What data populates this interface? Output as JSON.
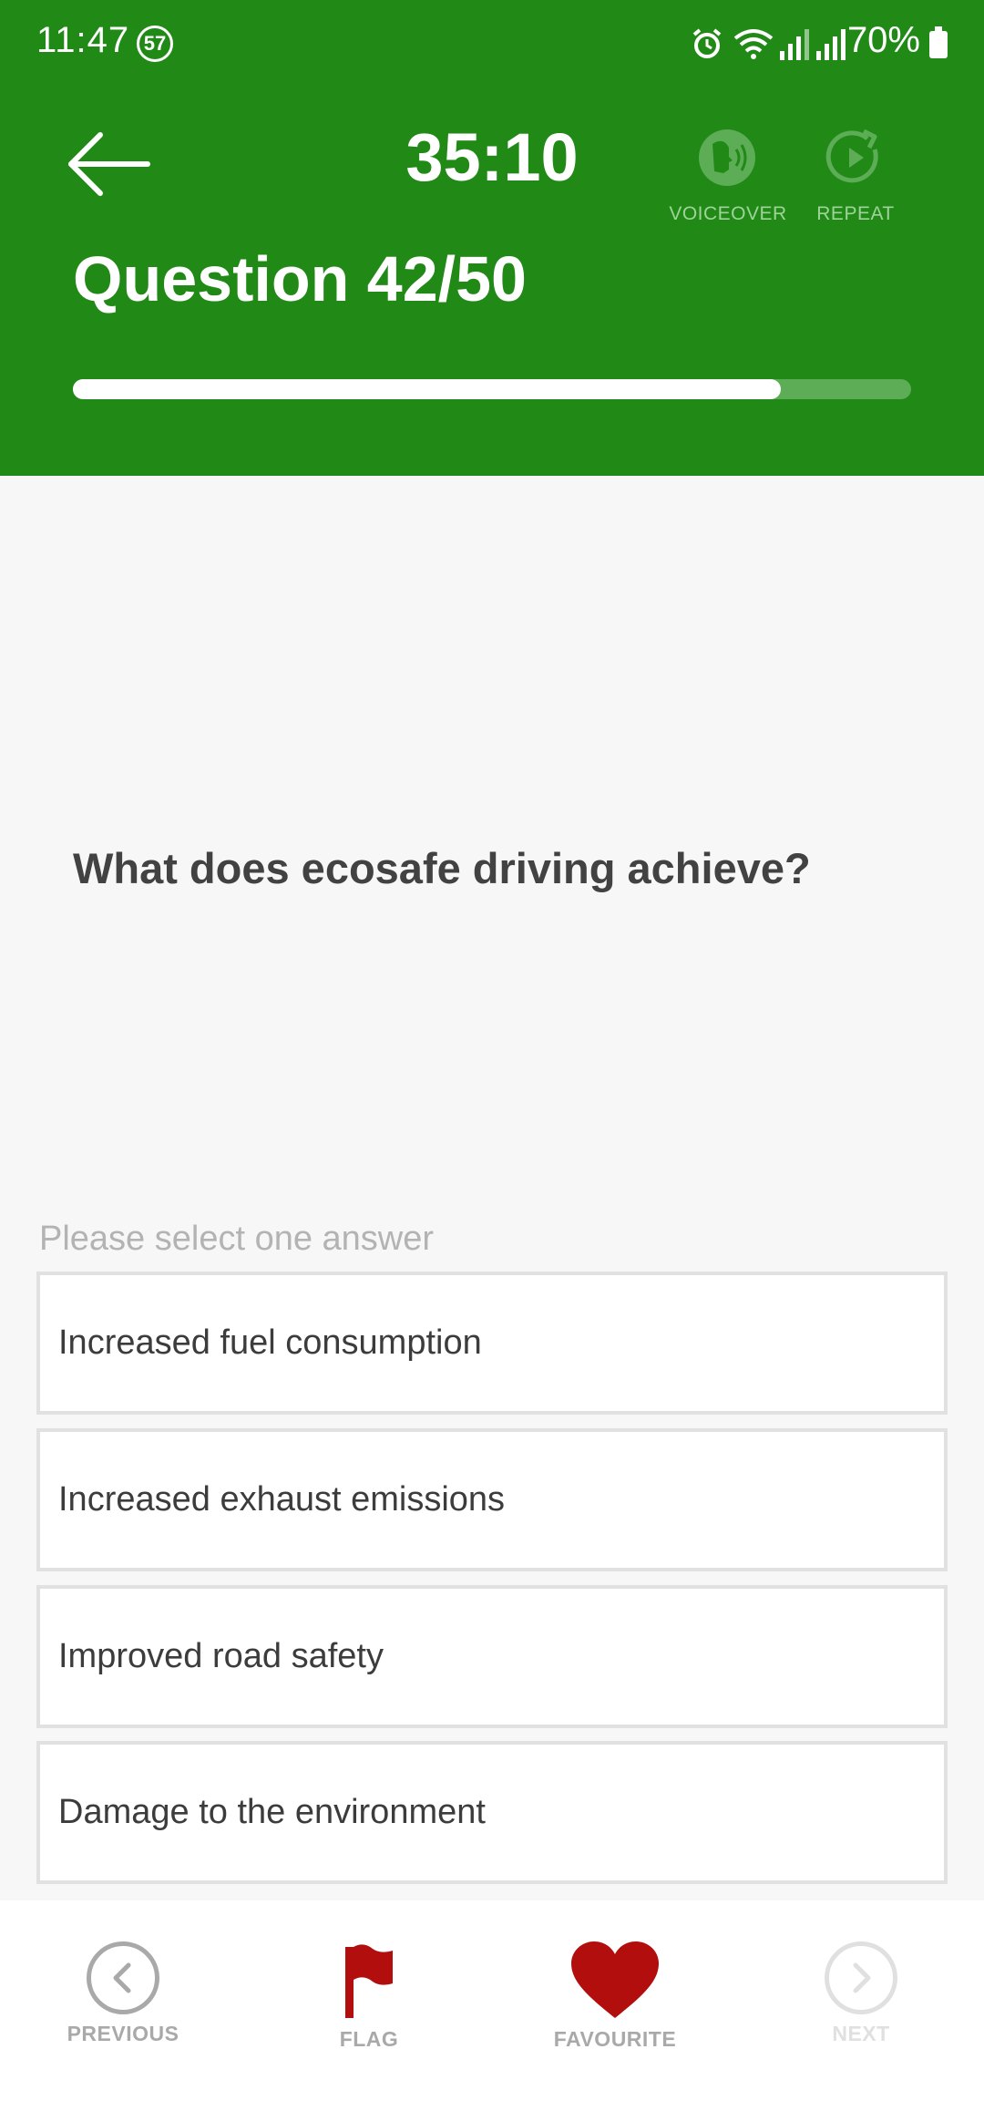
{
  "status_bar": {
    "time": "11:47",
    "notification_count": "57",
    "battery": "70%"
  },
  "header": {
    "timer": "35:10",
    "question_label": "Question 42/50",
    "progress_fraction": 0.845,
    "voiceover_label": "VOICEOVER",
    "repeat_label": "REPEAT"
  },
  "question": {
    "text": "What does ecosafe driving achieve?",
    "instruction": "Please select one answer",
    "answers": [
      "Increased fuel consumption",
      "Increased exhaust emissions",
      "Improved road safety",
      "Damage to the environment"
    ]
  },
  "bottom_nav": {
    "previous": "PREVIOUS",
    "flag": "FLAG",
    "favourite": "FAVOURITE",
    "next": "NEXT"
  },
  "colors": {
    "header_green": "#218a17",
    "flag_red": "#b20e0e",
    "favourite_red": "#b20e0e",
    "disabled_gray": "#e0e0e0"
  },
  "icons": [
    "back-arrow-icon",
    "voiceover-icon",
    "repeat-icon",
    "previous-icon",
    "flag-icon",
    "heart-icon",
    "next-icon",
    "alarm-icon",
    "wifi-icon",
    "signal-icon",
    "battery-icon"
  ]
}
